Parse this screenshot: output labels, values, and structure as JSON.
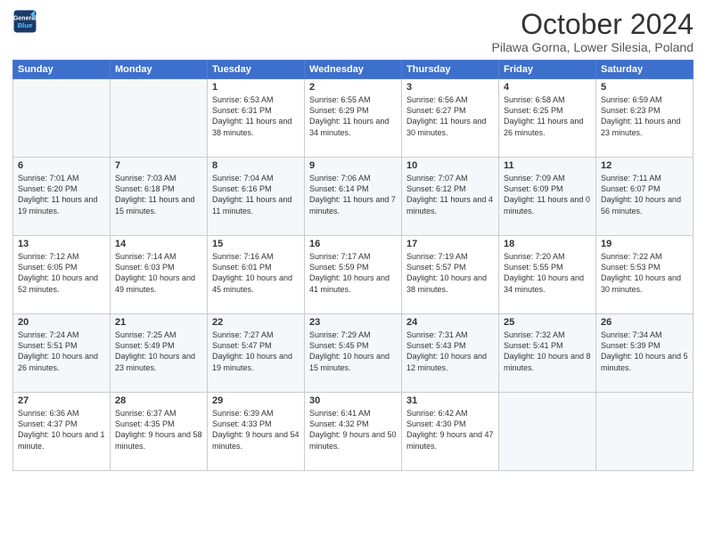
{
  "header": {
    "logo_line1": "General",
    "logo_line2": "Blue",
    "month": "October 2024",
    "location": "Pilawa Gorna, Lower Silesia, Poland"
  },
  "days_of_week": [
    "Sunday",
    "Monday",
    "Tuesday",
    "Wednesday",
    "Thursday",
    "Friday",
    "Saturday"
  ],
  "weeks": [
    [
      {
        "day": "",
        "info": ""
      },
      {
        "day": "",
        "info": ""
      },
      {
        "day": "1",
        "info": "Sunrise: 6:53 AM\nSunset: 6:31 PM\nDaylight: 11 hours and 38 minutes."
      },
      {
        "day": "2",
        "info": "Sunrise: 6:55 AM\nSunset: 6:29 PM\nDaylight: 11 hours and 34 minutes."
      },
      {
        "day": "3",
        "info": "Sunrise: 6:56 AM\nSunset: 6:27 PM\nDaylight: 11 hours and 30 minutes."
      },
      {
        "day": "4",
        "info": "Sunrise: 6:58 AM\nSunset: 6:25 PM\nDaylight: 11 hours and 26 minutes."
      },
      {
        "day": "5",
        "info": "Sunrise: 6:59 AM\nSunset: 6:23 PM\nDaylight: 11 hours and 23 minutes."
      }
    ],
    [
      {
        "day": "6",
        "info": "Sunrise: 7:01 AM\nSunset: 6:20 PM\nDaylight: 11 hours and 19 minutes."
      },
      {
        "day": "7",
        "info": "Sunrise: 7:03 AM\nSunset: 6:18 PM\nDaylight: 11 hours and 15 minutes."
      },
      {
        "day": "8",
        "info": "Sunrise: 7:04 AM\nSunset: 6:16 PM\nDaylight: 11 hours and 11 minutes."
      },
      {
        "day": "9",
        "info": "Sunrise: 7:06 AM\nSunset: 6:14 PM\nDaylight: 11 hours and 7 minutes."
      },
      {
        "day": "10",
        "info": "Sunrise: 7:07 AM\nSunset: 6:12 PM\nDaylight: 11 hours and 4 minutes."
      },
      {
        "day": "11",
        "info": "Sunrise: 7:09 AM\nSunset: 6:09 PM\nDaylight: 11 hours and 0 minutes."
      },
      {
        "day": "12",
        "info": "Sunrise: 7:11 AM\nSunset: 6:07 PM\nDaylight: 10 hours and 56 minutes."
      }
    ],
    [
      {
        "day": "13",
        "info": "Sunrise: 7:12 AM\nSunset: 6:05 PM\nDaylight: 10 hours and 52 minutes."
      },
      {
        "day": "14",
        "info": "Sunrise: 7:14 AM\nSunset: 6:03 PM\nDaylight: 10 hours and 49 minutes."
      },
      {
        "day": "15",
        "info": "Sunrise: 7:16 AM\nSunset: 6:01 PM\nDaylight: 10 hours and 45 minutes."
      },
      {
        "day": "16",
        "info": "Sunrise: 7:17 AM\nSunset: 5:59 PM\nDaylight: 10 hours and 41 minutes."
      },
      {
        "day": "17",
        "info": "Sunrise: 7:19 AM\nSunset: 5:57 PM\nDaylight: 10 hours and 38 minutes."
      },
      {
        "day": "18",
        "info": "Sunrise: 7:20 AM\nSunset: 5:55 PM\nDaylight: 10 hours and 34 minutes."
      },
      {
        "day": "19",
        "info": "Sunrise: 7:22 AM\nSunset: 5:53 PM\nDaylight: 10 hours and 30 minutes."
      }
    ],
    [
      {
        "day": "20",
        "info": "Sunrise: 7:24 AM\nSunset: 5:51 PM\nDaylight: 10 hours and 26 minutes."
      },
      {
        "day": "21",
        "info": "Sunrise: 7:25 AM\nSunset: 5:49 PM\nDaylight: 10 hours and 23 minutes."
      },
      {
        "day": "22",
        "info": "Sunrise: 7:27 AM\nSunset: 5:47 PM\nDaylight: 10 hours and 19 minutes."
      },
      {
        "day": "23",
        "info": "Sunrise: 7:29 AM\nSunset: 5:45 PM\nDaylight: 10 hours and 15 minutes."
      },
      {
        "day": "24",
        "info": "Sunrise: 7:31 AM\nSunset: 5:43 PM\nDaylight: 10 hours and 12 minutes."
      },
      {
        "day": "25",
        "info": "Sunrise: 7:32 AM\nSunset: 5:41 PM\nDaylight: 10 hours and 8 minutes."
      },
      {
        "day": "26",
        "info": "Sunrise: 7:34 AM\nSunset: 5:39 PM\nDaylight: 10 hours and 5 minutes."
      }
    ],
    [
      {
        "day": "27",
        "info": "Sunrise: 6:36 AM\nSunset: 4:37 PM\nDaylight: 10 hours and 1 minute."
      },
      {
        "day": "28",
        "info": "Sunrise: 6:37 AM\nSunset: 4:35 PM\nDaylight: 9 hours and 58 minutes."
      },
      {
        "day": "29",
        "info": "Sunrise: 6:39 AM\nSunset: 4:33 PM\nDaylight: 9 hours and 54 minutes."
      },
      {
        "day": "30",
        "info": "Sunrise: 6:41 AM\nSunset: 4:32 PM\nDaylight: 9 hours and 50 minutes."
      },
      {
        "day": "31",
        "info": "Sunrise: 6:42 AM\nSunset: 4:30 PM\nDaylight: 9 hours and 47 minutes."
      },
      {
        "day": "",
        "info": ""
      },
      {
        "day": "",
        "info": ""
      }
    ]
  ]
}
